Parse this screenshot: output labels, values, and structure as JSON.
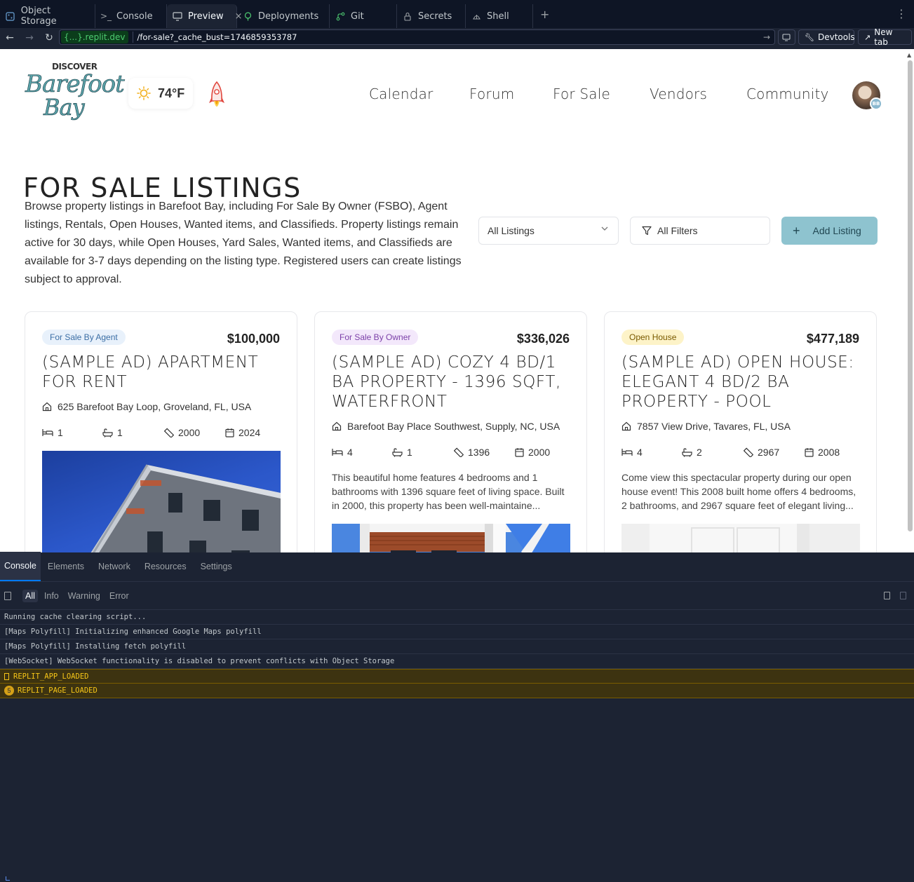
{
  "ide": {
    "tabs": [
      {
        "label": "Object Storage",
        "icon": "storage-icon"
      },
      {
        "label": "Console",
        "icon": "terminal-prompt-icon"
      },
      {
        "label": "Preview",
        "icon": "monitor-icon"
      },
      {
        "label": "Deployments",
        "icon": "deploy-icon"
      },
      {
        "label": "Git",
        "icon": "git-branch-icon"
      },
      {
        "label": "Secrets",
        "icon": "lock-icon"
      },
      {
        "label": "Shell",
        "icon": "shell-icon"
      }
    ],
    "active_tab": "Preview"
  },
  "urlbar": {
    "host": "{...}.replit.dev",
    "path": "/for-sale?_cache_bust=1746859353787",
    "devtools_label": "Devtools",
    "newtab_label": "New tab"
  },
  "site": {
    "logo": {
      "line1": "DISCOVER",
      "line2": "Barefoot",
      "line3": "Bay"
    },
    "weather": {
      "temp": "74°F",
      "icon": "sun-icon"
    },
    "nav": [
      "Calendar",
      "Forum",
      "For Sale",
      "Vendors",
      "Community"
    ],
    "avatar_initials": "BB",
    "title": "FOR SALE LISTINGS",
    "intro": "Browse property listings in Barefoot Bay, including For Sale By Owner (FSBO), Agent listings, Rentals, Open Houses, Wanted items, and Classifieds. Property listings remain active for 30 days, while Open Houses, Yard Sales, Wanted items, and Classifieds are available for 3-7 days depending on the listing type. Registered users can create listings subject to approval.",
    "listing_select": "All Listings",
    "filters_label": "All Filters",
    "add_listing_label": "Add Listing"
  },
  "listings": [
    {
      "badge": "For Sale By Agent",
      "badge_bg": "#e8f1fb",
      "badge_fg": "#3b6ea5",
      "price": "$100,000",
      "title": "(SAMPLE AD) APARTMENT FOR RENT",
      "address": "625 Barefoot Bay Loop, Groveland, FL, USA",
      "beds": "1",
      "baths": "1",
      "sqft": "2000",
      "year": "2024",
      "description": ""
    },
    {
      "badge": "For Sale By Owner",
      "badge_bg": "#f3e8fb",
      "badge_fg": "#7b3fa8",
      "price": "$336,026",
      "title": "(SAMPLE AD) COZY 4 BD/1 BA PROPERTY - 1396 SQFT, WATERFRONT",
      "address": "Barefoot Bay Place Southwest, Supply, NC, USA",
      "beds": "4",
      "baths": "1",
      "sqft": "1396",
      "year": "2000",
      "description": "This beautiful home features 4 bedrooms and 1 bathrooms with 1396 square feet of living space. Built in 2000, this property has been well-maintaine..."
    },
    {
      "badge": "Open House",
      "badge_bg": "#fdf3c8",
      "badge_fg": "#7a5a00",
      "price": "$477,189",
      "title": "(SAMPLE AD) OPEN HOUSE: ELEGANT 4 BD/2 BA PROPERTY - POOL",
      "address": "7857 View Drive, Tavares, FL, USA",
      "beds": "4",
      "baths": "2",
      "sqft": "2967",
      "year": "2008",
      "description": "Come view this spectacular property during our open house event! This 2008 built home offers 4 bedrooms, 2 bathrooms, and 2967 square feet of elegant living..."
    }
  ],
  "devtools": {
    "tabs": [
      "Console",
      "Elements",
      "Network",
      "Resources",
      "Settings"
    ],
    "active_tab": "Console",
    "filters": [
      "All",
      "Info",
      "Warning",
      "Error"
    ],
    "active_filter": "All",
    "logs": [
      {
        "text": "Running cache clearing script...",
        "level": "log"
      },
      {
        "text": "[Maps Polyfill] Initializing enhanced Google Maps polyfill",
        "level": "log"
      },
      {
        "text": "[Maps Polyfill] Installing fetch polyfill",
        "level": "log"
      },
      {
        "text": "[WebSocket] WebSocket functionality is disabled to prevent conflicts with Object Storage",
        "level": "log"
      },
      {
        "text": "REPLIT_APP_LOADED",
        "level": "warn"
      },
      {
        "text": "REPLIT_PAGE_LOADED",
        "level": "warn",
        "count": "5"
      }
    ]
  }
}
